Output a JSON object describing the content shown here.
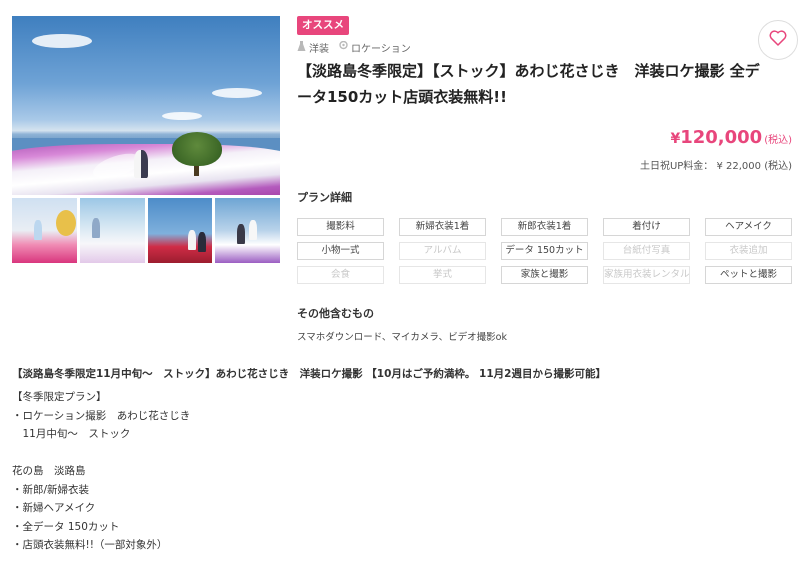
{
  "badge": "オススメ",
  "tags": [
    "洋装",
    "ロケーション"
  ],
  "title": "【淡路島冬季限定】【ストック】あわじ花さじき　洋装ロケ撮影 全データ150カット店頭衣装無料!!",
  "price": {
    "yen": "¥",
    "amount": "120,000",
    "tax": "(税込)"
  },
  "extra_fee": "土日祝UP料金：  ¥ 22,000 (税込)",
  "plan_details_title": "プラン詳細",
  "plan_items": [
    {
      "label": "撮影料",
      "active": true
    },
    {
      "label": "新婦衣装1着",
      "active": true
    },
    {
      "label": "新郎衣装1着",
      "active": true
    },
    {
      "label": "着付け",
      "active": true
    },
    {
      "label": "ヘアメイク",
      "active": true
    },
    {
      "label": "小物一式",
      "active": true
    },
    {
      "label": "アルバム",
      "active": false
    },
    {
      "label": "データ 150カット",
      "active": true
    },
    {
      "label": "台紙付写真",
      "active": false
    },
    {
      "label": "衣装追加",
      "active": false
    },
    {
      "label": "会食",
      "active": false
    },
    {
      "label": "挙式",
      "active": false
    },
    {
      "label": "家族と撮影",
      "active": true
    },
    {
      "label": "家族用衣装レンタル",
      "active": false
    },
    {
      "label": "ペットと撮影",
      "active": true
    }
  ],
  "other_title": "その他含むもの",
  "other_text": "スマホダウンロード、マイカメラ、ビデオ撮影ok",
  "description": {
    "heading": "【淡路島冬季限定11月中旬～　ストック】あわじ花さじき　洋装ロケ撮影 【10月はご予約満枠。 11月2週目から撮影可能】",
    "lines": [
      "【冬季限定プラン】",
      "・ロケーション撮影　あわじ花さじき",
      "　11月中旬～　ストック",
      "",
      "花の島　淡路島",
      "・新郎/新婦衣装",
      "・新婦ヘアメイク",
      "・全データ 150カット",
      "・店頭衣装無料!!（一部対象外）"
    ]
  },
  "colors": {
    "accent": "#e8467c",
    "chip_border": "#d6d6d6",
    "chip_off_text": "#c8c8c8"
  },
  "icons": {
    "favorite": "heart-icon",
    "dress": "dress-icon",
    "location": "pin-icon"
  }
}
